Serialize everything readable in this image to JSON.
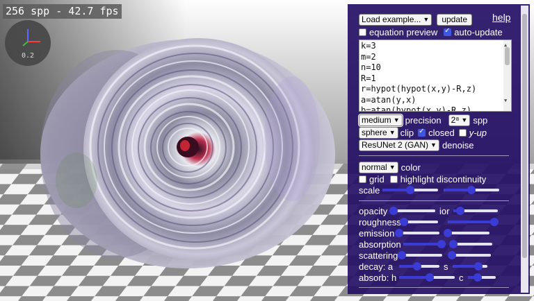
{
  "hud": {
    "fps_text": "256 spp - 42.7 fps",
    "axes_value": "0.2"
  },
  "panel": {
    "load_example": "Load example...",
    "update": "update",
    "help": "help",
    "equation_preview": {
      "label": "equation preview",
      "checked": false
    },
    "auto_update": {
      "label": "auto-update",
      "checked": true
    },
    "code_lines": [
      "k=3",
      "m=2",
      "n=10",
      "R=1",
      "r=hypot(hypot(x,y)-R,z)",
      "a=atan(y,x)",
      "b=atan(hypot(x,y)-R,z)"
    ],
    "precision": {
      "value": "medium",
      "label": "precision"
    },
    "spp": {
      "value": "2⁸",
      "label": "spp"
    },
    "clip": {
      "value": "sphere",
      "label": "clip"
    },
    "closed": {
      "label": "closed",
      "checked": true
    },
    "y_up": {
      "label": "y-up",
      "checked": false
    },
    "denoise": {
      "value": "ResUNet 2 (GAN)",
      "label": "denoise"
    },
    "color": {
      "value": "normal",
      "label": "color"
    },
    "grid": {
      "label": "grid",
      "checked": false
    },
    "highlight": {
      "label": "highlight discontinuity",
      "checked": false
    },
    "scale": {
      "label": "scale",
      "left": 0.5,
      "right": 0.5
    },
    "material": [
      {
        "label": "opacity",
        "value": 0.0,
        "mid_label": "ior",
        "mid_value": 0.15
      },
      {
        "label": "roughness",
        "value": 0.05,
        "right_value": 0.95
      },
      {
        "label": "emission",
        "value": 0.0,
        "right_value": 0.0
      },
      {
        "label": "absorption",
        "value": 0.95,
        "right_value": 0.0
      },
      {
        "label": "scattering",
        "value": 0.0,
        "right_value": 0.0
      }
    ],
    "decay": {
      "label": "decay: a",
      "value": 0.45,
      "mid_label": "s",
      "mid_value": 0.75
    },
    "absorb": {
      "label": "absorb: h",
      "value": 0.55,
      "mid_label": "c",
      "mid_value": 0.35
    }
  },
  "colors": {
    "panel_bg": "#261266",
    "accent": "#3b3bd6"
  }
}
